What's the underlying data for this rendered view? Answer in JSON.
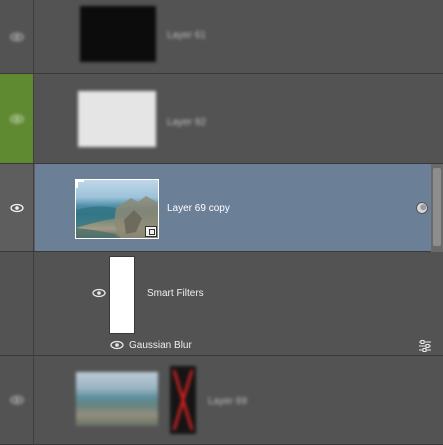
{
  "layers_panel": {
    "layers": [
      {
        "name": "Layer 61"
      },
      {
        "name": "Layer 92"
      },
      {
        "name": "Layer 69 copy"
      },
      {
        "name": "Layer 69"
      }
    ],
    "smart_filters": {
      "label": "Smart Filters",
      "filters": [
        {
          "name": "Gaussian Blur"
        }
      ]
    },
    "colors": {
      "panel_bg": "#535353",
      "selected_row": "#6b7f97",
      "visibility_highlight": "#5f8a32",
      "mask_x": "#d81818"
    },
    "icons": {
      "visibility": "eye-icon",
      "smart_object_badge": "smart-object-icon",
      "filter_options": "filter-blending-options-icon",
      "expand_toggle": "filter-toggle-icon"
    }
  }
}
